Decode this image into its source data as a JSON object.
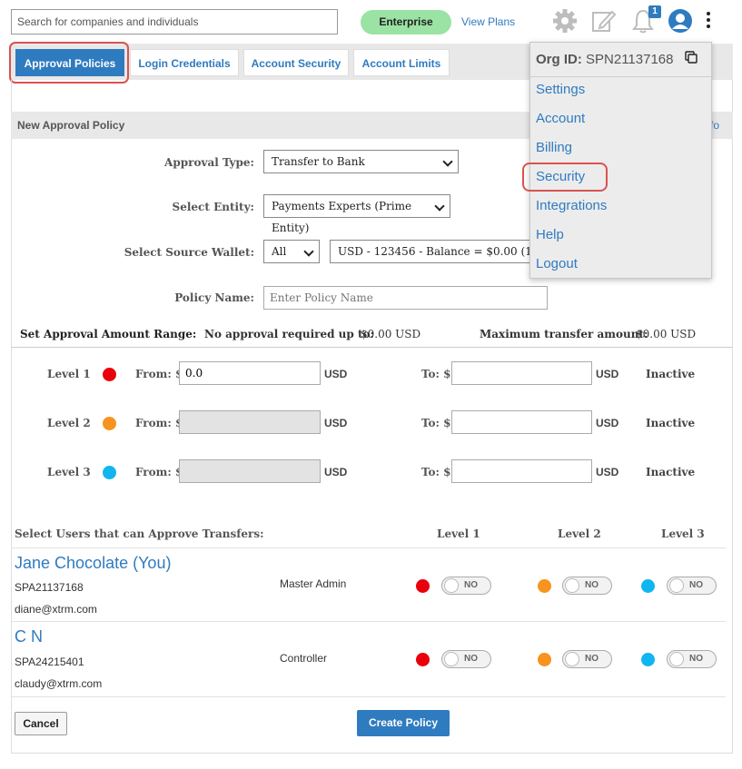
{
  "header": {
    "search_placeholder": "Search for companies and individuals",
    "plan_badge": "Enterprise",
    "view_plans": "View Plans",
    "notification_count": "1"
  },
  "tabs": [
    {
      "label": "Approval Policies",
      "active": true
    },
    {
      "label": "Login Credentials",
      "active": false
    },
    {
      "label": "Account Security",
      "active": false
    },
    {
      "label": "Account Limits",
      "active": false
    }
  ],
  "section": {
    "title": "New Approval Policy",
    "info_fragment": "fo"
  },
  "form": {
    "approval_type_label": "Approval Type:",
    "approval_type_value": "Transfer to Bank",
    "entity_label": "Select Entity:",
    "entity_value": "Payments Experts (Prime Entity)",
    "source_wallet_label": "Select Source Wallet:",
    "source_wallet_filter": "All",
    "source_wallet_value": "USD - 123456 - Balance = $0.00 (1187",
    "policy_name_label": "Policy Name:",
    "policy_name_placeholder": "Enter Policy Name"
  },
  "range": {
    "label": "Set Approval Amount Range:",
    "no_approval_label": "No approval required up to:",
    "no_approval_value": "$0.00 USD",
    "max_label": "Maximum transfer amount:",
    "max_value": "$0.00 USD"
  },
  "levels": [
    {
      "label": "Level 1",
      "color": "#e8000c",
      "from_label": "From: $",
      "from_value": "0.0",
      "currency": "USD",
      "to_label": "To: $",
      "to_value": "",
      "status": "Inactive"
    },
    {
      "label": "Level 2",
      "color": "#f7931e",
      "from_label": "From: $",
      "from_value": "",
      "currency": "USD",
      "to_label": "To: $",
      "to_value": "",
      "status": "Inactive"
    },
    {
      "label": "Level 3",
      "color": "#11b6f0",
      "from_label": "From: $",
      "from_value": "",
      "currency": "USD",
      "to_label": "To: $",
      "to_value": "",
      "status": "Inactive"
    }
  ],
  "users_header": {
    "label": "Select Users that can Approve Transfers:",
    "level1": "Level 1",
    "level2": "Level 2",
    "level3": "Level 3"
  },
  "users": [
    {
      "name": "Jane Chocolate (You)",
      "id": "SPA21137168",
      "email": "diane@xtrm.com",
      "role": "Master Admin",
      "toggle_label": "NO"
    },
    {
      "name": "C N",
      "id": "SPA24215401",
      "email": "claudy@xtrm.com",
      "role": "Controller",
      "toggle_label": "NO"
    }
  ],
  "buttons": {
    "cancel": "Cancel",
    "create": "Create Policy"
  },
  "menu": {
    "org_label": "Org ID:",
    "org_value": "SPN21137168",
    "items": [
      "Settings",
      "Account",
      "Billing",
      "Security",
      "Integrations",
      "Help",
      "Logout"
    ]
  },
  "colors": {
    "accent": "#2f7bc0",
    "highlight": "#d9534f",
    "plan_badge_bg": "#9be3a4"
  }
}
